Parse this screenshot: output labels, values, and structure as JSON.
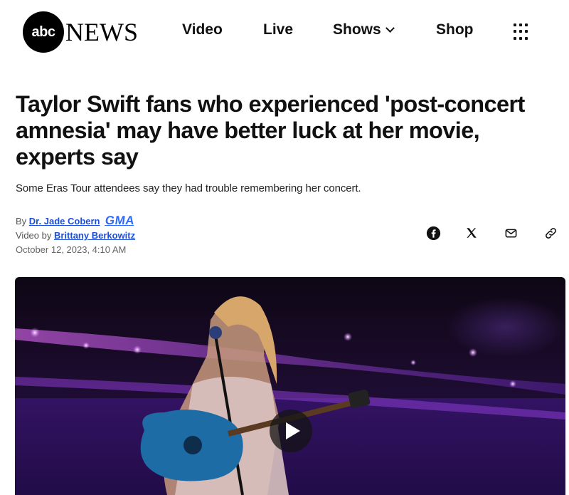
{
  "header": {
    "logo": {
      "badge": "abc",
      "word": "NEWS"
    },
    "nav": {
      "video": "Video",
      "live": "Live",
      "shows": "Shows",
      "shop": "Shop"
    },
    "menu_icon": "grid-menu-icon"
  },
  "article": {
    "headline": "Taylor Swift fans who experienced 'post-concert amnesia' may have better luck at her movie, experts say",
    "subheadline": "Some Eras Tour attendees say they had trouble remembering her concert.",
    "byline": {
      "by_prefix": "By",
      "author": "Dr. Jade Cobern",
      "author_org": "GMA",
      "video_prefix": "Video by",
      "video_author": "Brittany Berkowitz",
      "date": "October 12, 2023, 4:10 AM"
    },
    "share": [
      "facebook-icon",
      "x-icon",
      "mail-icon",
      "link-icon"
    ]
  },
  "media": {
    "type": "video",
    "play_icon": "play-icon"
  },
  "colors": {
    "link": "#1d4ed8",
    "gma": "#2f6bff",
    "text": "#111111"
  }
}
